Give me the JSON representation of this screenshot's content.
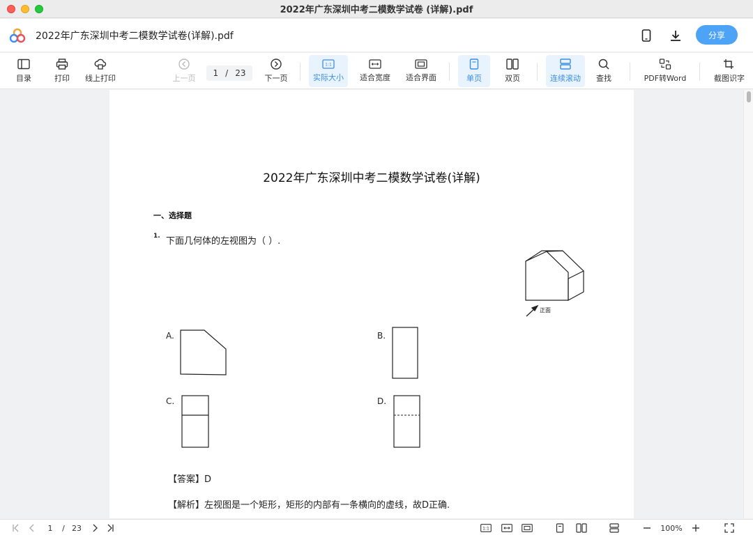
{
  "window": {
    "title": "2022年广东深圳中考二模数学试卷 (详解).pdf"
  },
  "header": {
    "doc_title": "2022年广东深圳中考二模数学试卷(详解).pdf",
    "share_label": "分享",
    "accent_color": "#4da3f5"
  },
  "toolbar": {
    "toc": "目录",
    "print": "打印",
    "online_print": "线上打印",
    "prev_page": "上一页",
    "current_page": "1",
    "page_sep": "/",
    "total_pages": "23",
    "next_page": "下一页",
    "actual_size": "实际大小",
    "fit_width": "适合宽度",
    "fit_window": "适合界面",
    "single_page": "单页",
    "double_page": "双页",
    "continuous_scroll": "连续滚动",
    "find": "查找",
    "pdf_to_word": "PDF转Word",
    "ocr": "截图识字",
    "active_color": "#3a8ee6"
  },
  "document": {
    "title": "2022年广东深圳中考二模数学试卷(详解)",
    "section": "一、选择题",
    "question_number": "1.",
    "question_text": "下面几何体的左视图为（   ）.",
    "front_label": "正面",
    "options": [
      "A.",
      "B.",
      "C.",
      "D."
    ],
    "answer_label": "【答案】",
    "answer_value": "D",
    "analysis_label": "【解析】",
    "analysis_text": "左视图是一个矩形，矩形的内部有一条横向的虚线，故D正确."
  },
  "bottombar": {
    "current_page": "1",
    "page_sep": "/",
    "total_pages": "23",
    "zoom": "100%",
    "actual_size_badge": "1:1"
  }
}
